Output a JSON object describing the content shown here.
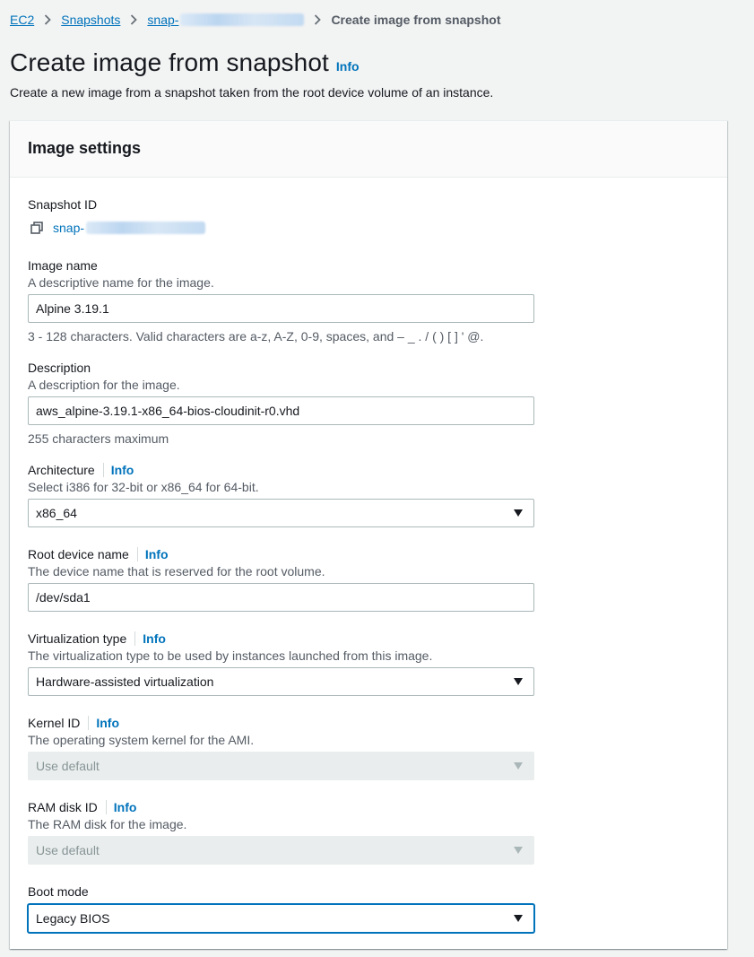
{
  "breadcrumb": {
    "items": [
      {
        "label": "EC2"
      },
      {
        "label": "Snapshots"
      },
      {
        "label": "snap-"
      }
    ],
    "current": "Create image from snapshot"
  },
  "header": {
    "title": "Create image from snapshot",
    "info": "Info",
    "description": "Create a new image from a snapshot taken from the root device volume of an instance."
  },
  "panel": {
    "title": "Image settings",
    "snapshot_id": {
      "label": "Snapshot ID",
      "value": "snap-"
    },
    "image_name": {
      "label": "Image name",
      "description": "A descriptive name for the image.",
      "value": "Alpine 3.19.1",
      "constraint": "3 - 128 characters. Valid characters are a-z, A-Z, 0-9, spaces, and – _ . / ( ) [ ] ' @."
    },
    "description": {
      "label": "Description",
      "description": "A description for the image.",
      "value": "aws_alpine-3.19.1-x86_64-bios-cloudinit-r0.vhd",
      "constraint": "255 characters maximum"
    },
    "architecture": {
      "label": "Architecture",
      "info": "Info",
      "description": "Select i386 for 32-bit or x86_64 for 64-bit.",
      "value": "x86_64"
    },
    "root_device": {
      "label": "Root device name",
      "info": "Info",
      "description": "The device name that is reserved for the root volume.",
      "value": "/dev/sda1"
    },
    "virtualization": {
      "label": "Virtualization type",
      "info": "Info",
      "description": "The virtualization type to be used by instances launched from this image.",
      "value": "Hardware-assisted virtualization"
    },
    "kernel": {
      "label": "Kernel ID",
      "info": "Info",
      "description": "The operating system kernel for the AMI.",
      "value": "Use default"
    },
    "ramdisk": {
      "label": "RAM disk ID",
      "info": "Info",
      "description": "The RAM disk for the image.",
      "value": "Use default"
    },
    "boot_mode": {
      "label": "Boot mode",
      "value": "Legacy BIOS"
    }
  },
  "colors": {
    "link": "#0073bb",
    "text": "#16191f",
    "secondary_text": "#545b64",
    "background": "#f2f3f3"
  },
  "icons": [
    "chevron-right-icon",
    "copy-icon",
    "caret-down-icon"
  ]
}
